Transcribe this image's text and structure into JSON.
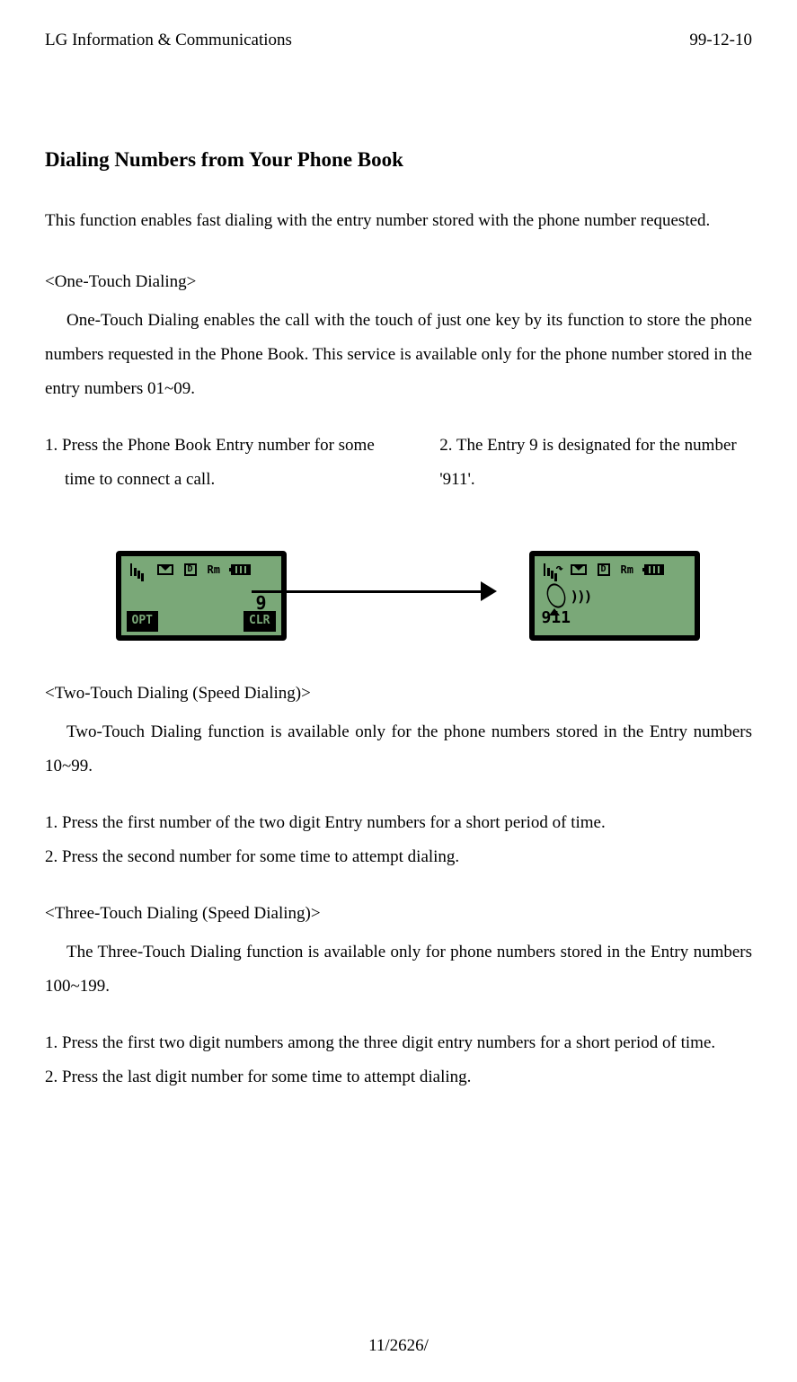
{
  "header": {
    "left": "LG Information & Communications",
    "right": "99-12-10"
  },
  "title": "Dialing Numbers from Your Phone Book",
  "intro": "This function enables fast dialing with the entry number stored with the phone number requested.",
  "one_touch": {
    "label": "<One-Touch Dialing>",
    "desc": "One-Touch Dialing enables the call with the touch of just one key by its function to store the phone numbers requested in the Phone Book. This service is available only for the phone number stored in the entry numbers 01~09.",
    "step1": "1. Press the Phone Book Entry number for some time to connect a call.",
    "step2": "2. The Entry 9 is designated for the number '911'."
  },
  "screen1": {
    "d": "D",
    "rm": "Rm",
    "number": "9",
    "left_soft": "OPT",
    "right_soft": "CLR"
  },
  "screen2": {
    "d": "D",
    "rm": "Rm",
    "waves": ")))",
    "result": "911"
  },
  "two_touch": {
    "label": "<Two-Touch Dialing (Speed Dialing)>",
    "desc": "Two-Touch Dialing function is available only for the phone numbers stored in the Entry numbers 10~99.",
    "step1": "1.   Press the first number of the two digit Entry numbers for a short period of time.",
    "step2": "2.   Press the second number for some time to attempt dialing."
  },
  "three_touch": {
    "label": "<Three-Touch Dialing (Speed Dialing)>",
    "desc": "The Three-Touch Dialing function is available only for phone numbers stored in the Entry numbers 100~199.",
    "step1": "1.  Press the first two digit numbers among the three digit entry numbers for a short period of time.",
    "step2": "2.  Press the last digit number for some time to attempt dialing."
  },
  "footer": "11/2626/"
}
